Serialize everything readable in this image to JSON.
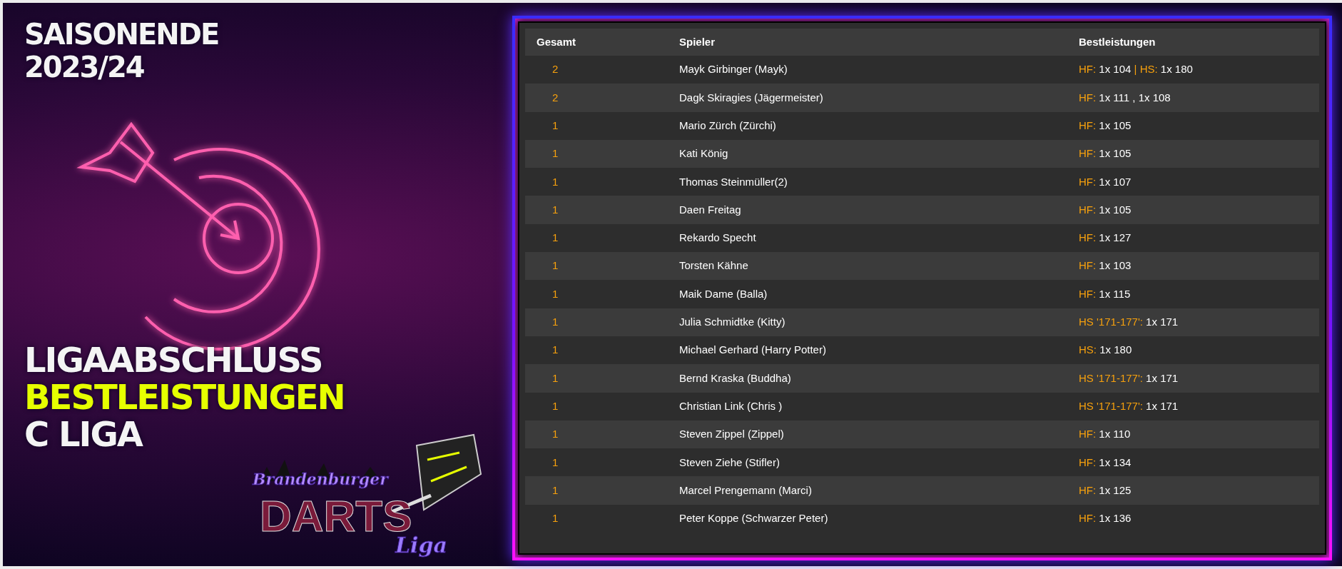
{
  "poster": {
    "lines": [
      {
        "text": "SAISONENDE",
        "kind": "top"
      },
      {
        "text": "2023/24",
        "kind": "top"
      },
      {
        "text": "LIGAABSCHLUSS",
        "kind": "plain"
      },
      {
        "text": "BESTLEISTUNGEN",
        "kind": "highlight"
      },
      {
        "text": "C LIGA",
        "kind": "plain"
      }
    ],
    "logo": {
      "script_top": "Brandenburger",
      "wordmark": "DARTS",
      "script_bottom": "Liga"
    }
  },
  "table": {
    "columns": [
      "Gesamt",
      "Spieler",
      "Bestleistungen"
    ],
    "rows": [
      {
        "total": "2",
        "player": "Mayk Girbinger (Mayk)",
        "best": [
          {
            "kind": "label",
            "text": "HF:"
          },
          {
            "kind": "value",
            "text": "1x 104"
          },
          {
            "kind": "label",
            "text": "|"
          },
          {
            "kind": "label",
            "text": "HS:"
          },
          {
            "kind": "value",
            "text": "1x 180"
          }
        ]
      },
      {
        "total": "2",
        "player": "Dagk Skiragies (Jägermeister)",
        "best": [
          {
            "kind": "label",
            "text": "HF:"
          },
          {
            "kind": "value",
            "text": "1x 111 , 1x 108"
          }
        ]
      },
      {
        "total": "1",
        "player": "Mario Zürch (Zürchi)",
        "best": [
          {
            "kind": "label",
            "text": "HF:"
          },
          {
            "kind": "value",
            "text": "1x 105"
          }
        ]
      },
      {
        "total": "1",
        "player": "Kati König",
        "best": [
          {
            "kind": "label",
            "text": "HF:"
          },
          {
            "kind": "value",
            "text": "1x 105"
          }
        ]
      },
      {
        "total": "1",
        "player": "Thomas Steinmüller(2)",
        "best": [
          {
            "kind": "label",
            "text": "HF:"
          },
          {
            "kind": "value",
            "text": "1x 107"
          }
        ]
      },
      {
        "total": "1",
        "player": "Daen Freitag",
        "best": [
          {
            "kind": "label",
            "text": "HF:"
          },
          {
            "kind": "value",
            "text": "1x 105"
          }
        ]
      },
      {
        "total": "1",
        "player": "Rekardo Specht",
        "best": [
          {
            "kind": "label",
            "text": "HF:"
          },
          {
            "kind": "value",
            "text": "1x 127"
          }
        ]
      },
      {
        "total": "1",
        "player": "Torsten Kähne",
        "best": [
          {
            "kind": "label",
            "text": "HF:"
          },
          {
            "kind": "value",
            "text": "1x 103"
          }
        ]
      },
      {
        "total": "1",
        "player": "Maik Dame (Balla)",
        "best": [
          {
            "kind": "label",
            "text": "HF:"
          },
          {
            "kind": "value",
            "text": "1x 115"
          }
        ]
      },
      {
        "total": "1",
        "player": "Julia Schmidtke (Kitty)",
        "best": [
          {
            "kind": "label",
            "text": "HS '171-177':"
          },
          {
            "kind": "value",
            "text": "1x 171"
          }
        ]
      },
      {
        "total": "1",
        "player": "Michael Gerhard (Harry Potter)",
        "best": [
          {
            "kind": "label",
            "text": "HS:"
          },
          {
            "kind": "value",
            "text": "1x 180"
          }
        ]
      },
      {
        "total": "1",
        "player": "Bernd Kraska (Buddha)",
        "best": [
          {
            "kind": "label",
            "text": "HS '171-177':"
          },
          {
            "kind": "value",
            "text": "1x 171"
          }
        ]
      },
      {
        "total": "1",
        "player": "Christian Link (Chris )",
        "best": [
          {
            "kind": "label",
            "text": "HS '171-177':"
          },
          {
            "kind": "value",
            "text": "1x 171"
          }
        ]
      },
      {
        "total": "1",
        "player": "Steven Zippel (Zippel)",
        "best": [
          {
            "kind": "label",
            "text": "HF:"
          },
          {
            "kind": "value",
            "text": "1x 110"
          }
        ]
      },
      {
        "total": "1",
        "player": "Steven Ziehe (Stifler)",
        "best": [
          {
            "kind": "label",
            "text": "HF:"
          },
          {
            "kind": "value",
            "text": "1x 134"
          }
        ]
      },
      {
        "total": "1",
        "player": "Marcel Prengemann (Marci)",
        "best": [
          {
            "kind": "label",
            "text": "HF:"
          },
          {
            "kind": "value",
            "text": "1x 125"
          }
        ]
      },
      {
        "total": "1",
        "player": "Peter Koppe (Schwarzer Peter)",
        "best": [
          {
            "kind": "label",
            "text": "HF:"
          },
          {
            "kind": "value",
            "text": "1x 136"
          }
        ]
      }
    ]
  }
}
